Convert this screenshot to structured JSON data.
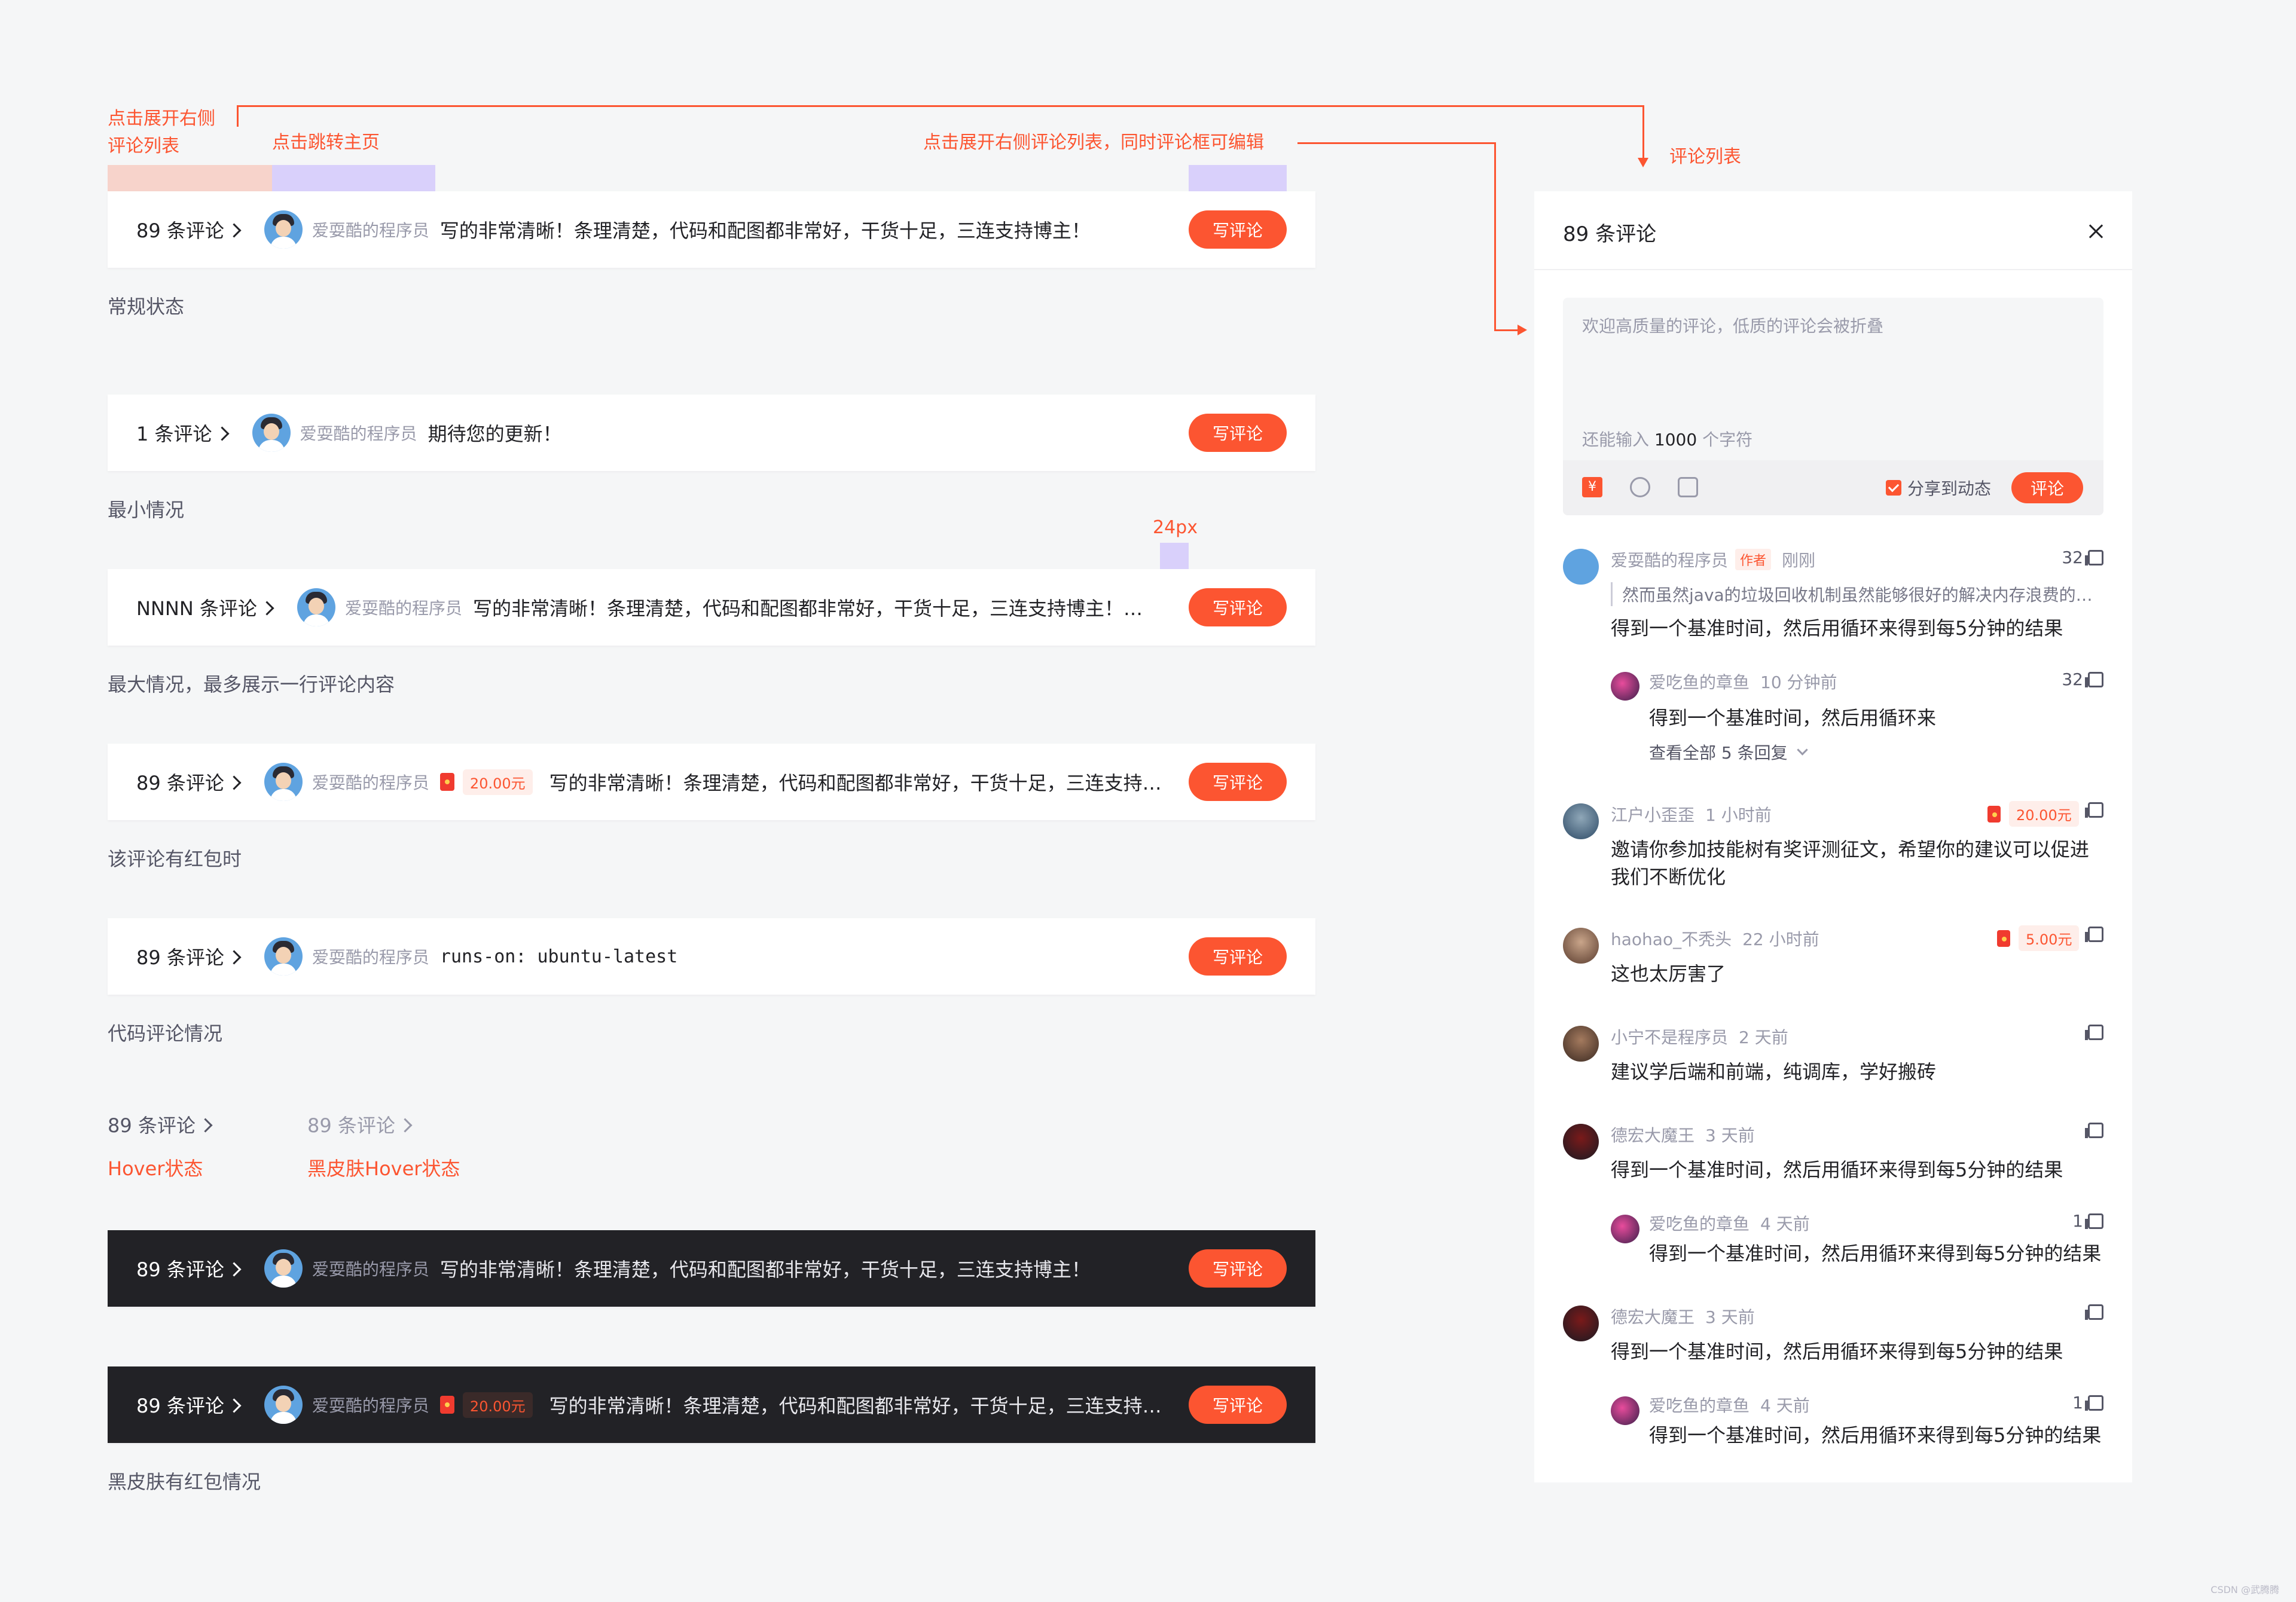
{
  "annotations": {
    "expand_list": "点击展开右侧\n评论列表",
    "jump_home": "点击跳转主页",
    "expand_edit": "点击展开右侧评论列表，同时评论框可编辑",
    "comment_list": "评论列表",
    "spacing": "24px"
  },
  "rows": [
    {
      "count": "89 条评论",
      "user": "爱耍酷的程序员",
      "content": "写的非常清晰！条理清楚，代码和配图都非常好，干货十足，三连支持博主！",
      "button": "写评论",
      "caption": "常规状态"
    },
    {
      "count": "1 条评论",
      "user": "爱耍酷的程序员",
      "content": "期待您的更新！",
      "button": "写评论",
      "caption": "最小情况"
    },
    {
      "count": "NNNN 条评论",
      "user": "爱耍酷的程序员",
      "content": "写的非常清晰！条理清楚，代码和配图都非常好，干货十足，三连支持博主！期待您的更新！",
      "button": "写评论",
      "caption": "最大情况，最多展示一行评论内容"
    },
    {
      "count": "89 条评论",
      "user": "爱耍酷的程序员",
      "redpack": "20.00元",
      "content": "写的非常清晰！条理清楚，代码和配图都非常好，干货十足，三连支持博主！",
      "button": "写评论",
      "caption": "该评论有红包时"
    },
    {
      "count": "89 条评论",
      "user": "爱耍酷的程序员",
      "content": "runs-on: ubuntu-latest",
      "button": "写评论",
      "caption": "代码评论情况"
    }
  ],
  "hover": {
    "normal_text": "89 条评论",
    "normal_caption": "Hover状态",
    "dark_text": "89 条评论",
    "dark_caption": "黑皮肤Hover状态"
  },
  "dark_rows": [
    {
      "count": "89 条评论",
      "user": "爱耍酷的程序员",
      "content": "写的非常清晰！条理清楚，代码和配图都非常好，干货十足，三连支持博主！",
      "button": "写评论"
    },
    {
      "count": "89 条评论",
      "user": "爱耍酷的程序员",
      "redpack": "20.00元",
      "content": "写的非常清晰！条理清楚，代码和配图都非常好，干货十足，三连支持博主！",
      "button": "写评论",
      "caption": "黑皮肤有红包情况"
    }
  ],
  "panel": {
    "title": "89 条评论",
    "placeholder": "欢迎高质量的评论，低质的评论会被折叠",
    "remain_prefix": "还能输入",
    "remain_count": "1000",
    "remain_suffix": "个字符",
    "rmb_icon": "¥",
    "share_label": "分享到动态",
    "submit": "评论",
    "comments": [
      {
        "user": "爱耍酷的程序员",
        "tag": "作者",
        "time": "刚刚",
        "likes": "32",
        "quote": "然而虽然java的垃圾回收机制虽然能够很好的解决内存浪费的问题，但是也会带来一些性能上的开销",
        "text": "得到一个基准时间，然后用循环来得到每5分钟的结果"
      },
      {
        "user": "爱吃鱼的章鱼",
        "time": "10 分钟前",
        "likes": "32",
        "text": "得到一个基准时间，然后用循环来",
        "reply": true
      },
      {
        "more": "查看全部 5 条回复"
      },
      {
        "user": "江户小歪歪",
        "time": "1 小时前",
        "redpack": "20.00元",
        "text": "邀请你参加技能树有奖评测征文，希望你的建议可以促进我们不断优化"
      },
      {
        "user": "haohao_不秃头",
        "time": "22 小时前",
        "redpack": "5.00元",
        "text": "这也太厉害了"
      },
      {
        "user": "小宁不是程序员",
        "time": "2 天前",
        "text": "建议学后端和前端，纯调库，学好搬砖"
      },
      {
        "user": "德宏大魔王",
        "time": "3 天前",
        "text": "得到一个基准时间，然后用循环来得到每5分钟的结果"
      },
      {
        "user": "爱吃鱼的章鱼",
        "time": "4 天前",
        "likes": "1",
        "text": "得到一个基准时间，然后用循环来得到每5分钟的结果",
        "reply": true
      },
      {
        "user": "德宏大魔王",
        "time": "3 天前",
        "text": "得到一个基准时间，然后用循环来得到每5分钟的结果"
      },
      {
        "user": "爱吃鱼的章鱼",
        "time": "4 天前",
        "likes": "1",
        "text": "得到一个基准时间，然后用循环来得到每5分钟的结果",
        "reply": true
      }
    ]
  },
  "watermark": "CSDN @武腾腾",
  "colors": {
    "accent": "#fc5531",
    "dark_bg": "#222226"
  }
}
